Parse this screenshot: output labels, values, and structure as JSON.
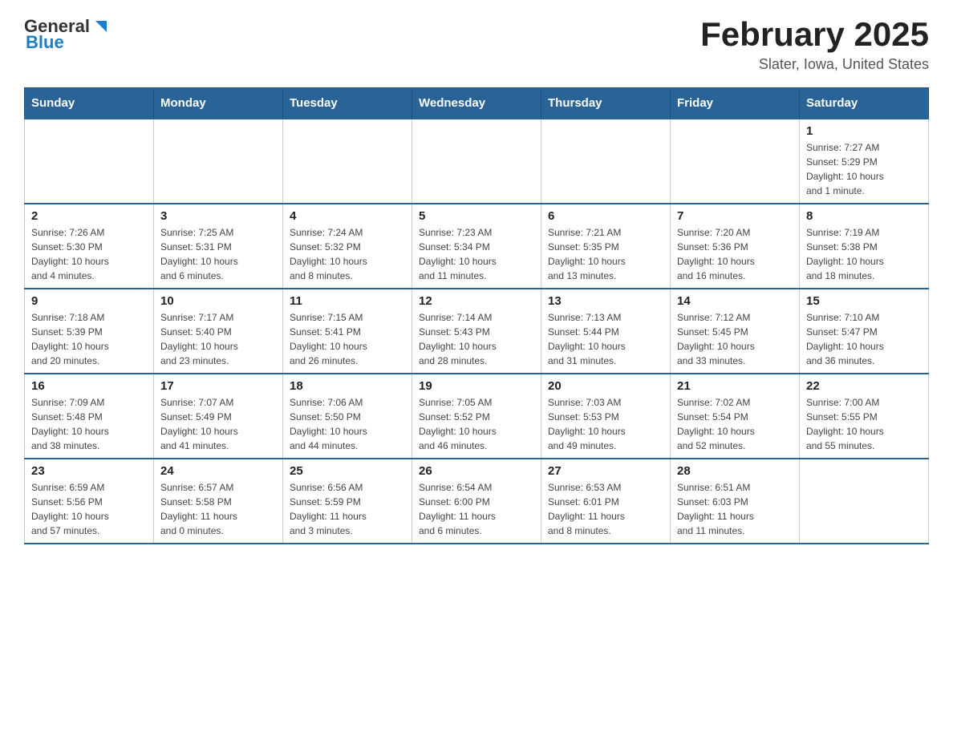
{
  "header": {
    "logo_general": "General",
    "logo_blue": "Blue",
    "title": "February 2025",
    "subtitle": "Slater, Iowa, United States"
  },
  "weekdays": [
    "Sunday",
    "Monday",
    "Tuesday",
    "Wednesday",
    "Thursday",
    "Friday",
    "Saturday"
  ],
  "weeks": [
    [
      {
        "day": "",
        "info": ""
      },
      {
        "day": "",
        "info": ""
      },
      {
        "day": "",
        "info": ""
      },
      {
        "day": "",
        "info": ""
      },
      {
        "day": "",
        "info": ""
      },
      {
        "day": "",
        "info": ""
      },
      {
        "day": "1",
        "info": "Sunrise: 7:27 AM\nSunset: 5:29 PM\nDaylight: 10 hours\nand 1 minute."
      }
    ],
    [
      {
        "day": "2",
        "info": "Sunrise: 7:26 AM\nSunset: 5:30 PM\nDaylight: 10 hours\nand 4 minutes."
      },
      {
        "day": "3",
        "info": "Sunrise: 7:25 AM\nSunset: 5:31 PM\nDaylight: 10 hours\nand 6 minutes."
      },
      {
        "day": "4",
        "info": "Sunrise: 7:24 AM\nSunset: 5:32 PM\nDaylight: 10 hours\nand 8 minutes."
      },
      {
        "day": "5",
        "info": "Sunrise: 7:23 AM\nSunset: 5:34 PM\nDaylight: 10 hours\nand 11 minutes."
      },
      {
        "day": "6",
        "info": "Sunrise: 7:21 AM\nSunset: 5:35 PM\nDaylight: 10 hours\nand 13 minutes."
      },
      {
        "day": "7",
        "info": "Sunrise: 7:20 AM\nSunset: 5:36 PM\nDaylight: 10 hours\nand 16 minutes."
      },
      {
        "day": "8",
        "info": "Sunrise: 7:19 AM\nSunset: 5:38 PM\nDaylight: 10 hours\nand 18 minutes."
      }
    ],
    [
      {
        "day": "9",
        "info": "Sunrise: 7:18 AM\nSunset: 5:39 PM\nDaylight: 10 hours\nand 20 minutes."
      },
      {
        "day": "10",
        "info": "Sunrise: 7:17 AM\nSunset: 5:40 PM\nDaylight: 10 hours\nand 23 minutes."
      },
      {
        "day": "11",
        "info": "Sunrise: 7:15 AM\nSunset: 5:41 PM\nDaylight: 10 hours\nand 26 minutes."
      },
      {
        "day": "12",
        "info": "Sunrise: 7:14 AM\nSunset: 5:43 PM\nDaylight: 10 hours\nand 28 minutes."
      },
      {
        "day": "13",
        "info": "Sunrise: 7:13 AM\nSunset: 5:44 PM\nDaylight: 10 hours\nand 31 minutes."
      },
      {
        "day": "14",
        "info": "Sunrise: 7:12 AM\nSunset: 5:45 PM\nDaylight: 10 hours\nand 33 minutes."
      },
      {
        "day": "15",
        "info": "Sunrise: 7:10 AM\nSunset: 5:47 PM\nDaylight: 10 hours\nand 36 minutes."
      }
    ],
    [
      {
        "day": "16",
        "info": "Sunrise: 7:09 AM\nSunset: 5:48 PM\nDaylight: 10 hours\nand 38 minutes."
      },
      {
        "day": "17",
        "info": "Sunrise: 7:07 AM\nSunset: 5:49 PM\nDaylight: 10 hours\nand 41 minutes."
      },
      {
        "day": "18",
        "info": "Sunrise: 7:06 AM\nSunset: 5:50 PM\nDaylight: 10 hours\nand 44 minutes."
      },
      {
        "day": "19",
        "info": "Sunrise: 7:05 AM\nSunset: 5:52 PM\nDaylight: 10 hours\nand 46 minutes."
      },
      {
        "day": "20",
        "info": "Sunrise: 7:03 AM\nSunset: 5:53 PM\nDaylight: 10 hours\nand 49 minutes."
      },
      {
        "day": "21",
        "info": "Sunrise: 7:02 AM\nSunset: 5:54 PM\nDaylight: 10 hours\nand 52 minutes."
      },
      {
        "day": "22",
        "info": "Sunrise: 7:00 AM\nSunset: 5:55 PM\nDaylight: 10 hours\nand 55 minutes."
      }
    ],
    [
      {
        "day": "23",
        "info": "Sunrise: 6:59 AM\nSunset: 5:56 PM\nDaylight: 10 hours\nand 57 minutes."
      },
      {
        "day": "24",
        "info": "Sunrise: 6:57 AM\nSunset: 5:58 PM\nDaylight: 11 hours\nand 0 minutes."
      },
      {
        "day": "25",
        "info": "Sunrise: 6:56 AM\nSunset: 5:59 PM\nDaylight: 11 hours\nand 3 minutes."
      },
      {
        "day": "26",
        "info": "Sunrise: 6:54 AM\nSunset: 6:00 PM\nDaylight: 11 hours\nand 6 minutes."
      },
      {
        "day": "27",
        "info": "Sunrise: 6:53 AM\nSunset: 6:01 PM\nDaylight: 11 hours\nand 8 minutes."
      },
      {
        "day": "28",
        "info": "Sunrise: 6:51 AM\nSunset: 6:03 PM\nDaylight: 11 hours\nand 11 minutes."
      },
      {
        "day": "",
        "info": ""
      }
    ]
  ]
}
